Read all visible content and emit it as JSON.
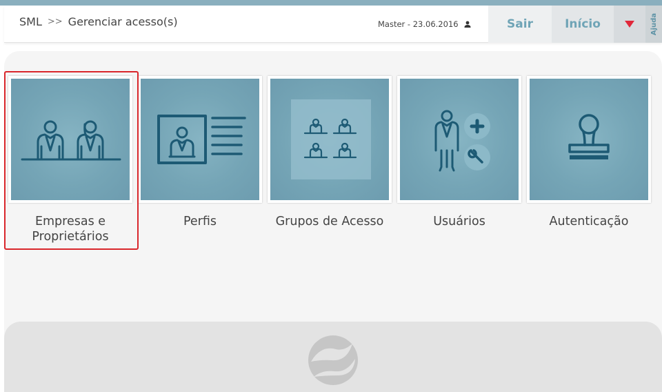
{
  "header": {
    "breadcrumb": [
      "SML",
      ">>",
      "Gerenciar acesso(s)"
    ],
    "user_info": "Master - 23.06.2016",
    "buttons": {
      "sair": "Sair",
      "inicio": "Início",
      "ajuda": "Ajuda"
    }
  },
  "tiles": [
    {
      "label": "Empresas e Proprietários",
      "icon": "companies-owners-icon",
      "selected": true
    },
    {
      "label": "Perfis",
      "icon": "profile-card-icon"
    },
    {
      "label": "Grupos de Acesso",
      "icon": "access-groups-icon"
    },
    {
      "label": "Usuários",
      "icon": "users-add-tools-icon"
    },
    {
      "label": "Autenticação",
      "icon": "stamp-icon"
    }
  ],
  "colors": {
    "accent": "#6fa4b6",
    "tile_bg": "#75a5b6",
    "icon_stroke": "#1d5a74",
    "highlight": "#d9262b",
    "dropdown_arrow": "#e0283a"
  },
  "footer": {
    "logo": "swirl-logo-icon"
  }
}
